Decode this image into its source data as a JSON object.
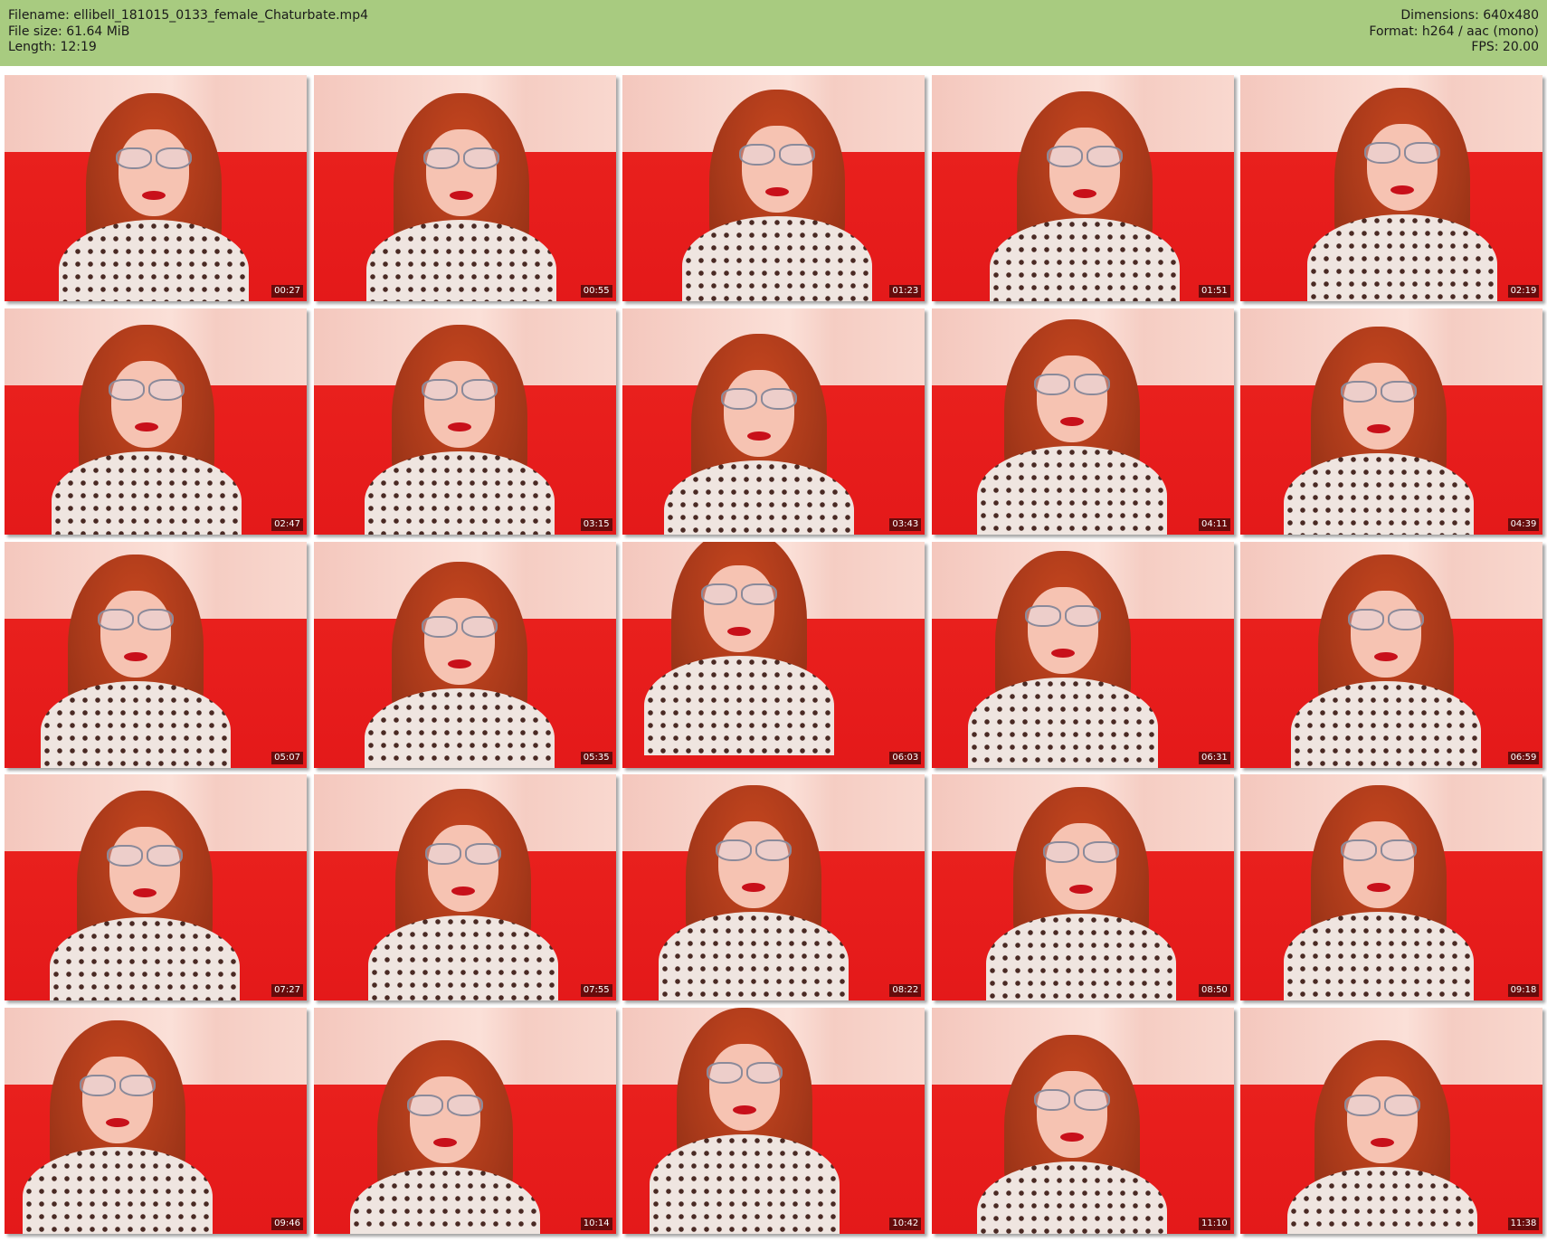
{
  "header": {
    "left": [
      "Filename: ellibell_181015_0133_female_Chaturbate.mp4",
      "File size: 61.64 MiB",
      "Length: 12:19"
    ],
    "right": [
      "Dimensions: 640x480",
      "Format: h264 / aac (mono)",
      "FPS: 20.00"
    ]
  },
  "thumbnails": [
    {
      "time": "00:27"
    },
    {
      "time": "00:55"
    },
    {
      "time": "01:23"
    },
    {
      "time": "01:51"
    },
    {
      "time": "02:19"
    },
    {
      "time": "02:47"
    },
    {
      "time": "03:15"
    },
    {
      "time": "03:43"
    },
    {
      "time": "04:11"
    },
    {
      "time": "04:39"
    },
    {
      "time": "05:07"
    },
    {
      "time": "05:35"
    },
    {
      "time": "06:03"
    },
    {
      "time": "06:31"
    },
    {
      "time": "06:59"
    },
    {
      "time": "07:27"
    },
    {
      "time": "07:55"
    },
    {
      "time": "08:22"
    },
    {
      "time": "08:50"
    },
    {
      "time": "09:18"
    },
    {
      "time": "09:46"
    },
    {
      "time": "10:14"
    },
    {
      "time": "10:42"
    },
    {
      "time": "11:10"
    },
    {
      "time": "11:38"
    }
  ],
  "colors": {
    "header_bg": "#a8cb80",
    "couch_red": "#e4191a",
    "wall_pink": "#f7cfc5",
    "hair": "#a8391a"
  }
}
